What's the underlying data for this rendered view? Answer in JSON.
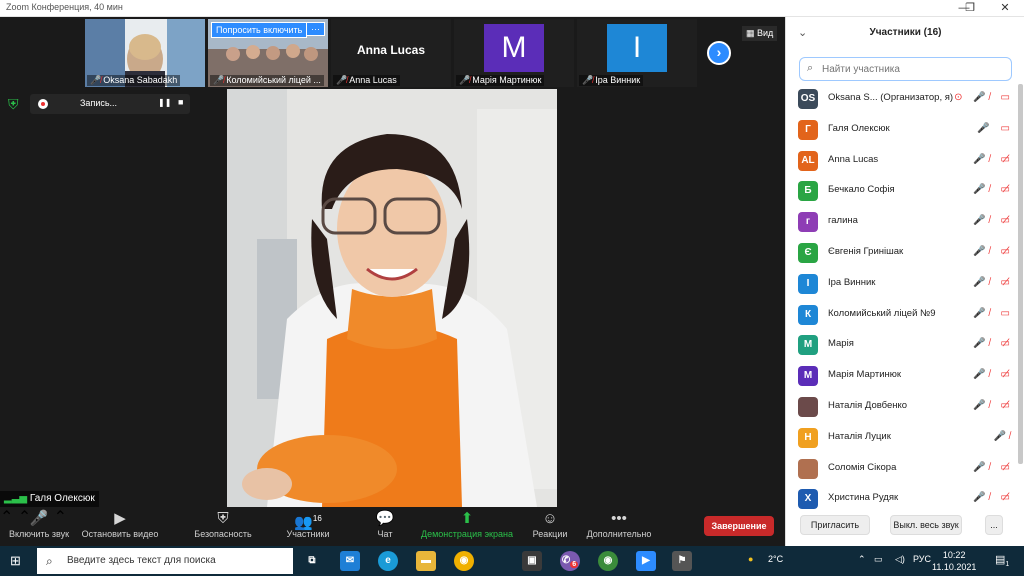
{
  "window": {
    "title": "Zoom Конференция, 40 мин",
    "min": "—",
    "max": "❐",
    "close": "✕"
  },
  "gallery": {
    "tiles": [
      {
        "name": "Oksana Sabadakh",
        "kind": "video",
        "bg": "#6a8fb0"
      },
      {
        "name": "Коломийський ліцей ...",
        "kind": "video",
        "bg": "#5d7b9d"
      },
      {
        "name": "Anna Lucas",
        "kind": "text",
        "big": "Anna Lucas"
      },
      {
        "name": "Марія Мартинюк",
        "kind": "avatar",
        "letter": "M",
        "color": "#5b2db8"
      },
      {
        "name": "Іра Винник",
        "kind": "avatar",
        "letter": "I",
        "color": "#1e87d6"
      }
    ],
    "ask_button": "Попросить включить",
    "more_button": "···",
    "next_button": "›",
    "view_button": "Вид"
  },
  "recording": {
    "label": "Запись...",
    "pause": "❚❚",
    "stop": "■"
  },
  "main_speaker": {
    "name": "Галя Олексюк"
  },
  "toolbar": {
    "unmute": "Включить звук",
    "stop_video": "Остановить видео",
    "security": "Безопасность",
    "participants": "Участники",
    "participants_count": "16",
    "chat": "Чат",
    "share": "Демонстрация экрана",
    "reactions": "Реакции",
    "more": "Дополнительно",
    "end": "Завершение"
  },
  "panel": {
    "title": "Участники (16)",
    "search_placeholder": "Найти участника",
    "participants": [
      {
        "initials": "OS",
        "name": "Oksana S...  (Организатор, я)",
        "color": "#3b4a5a",
        "icons": "⊙ 🎤̸ ▭"
      },
      {
        "initials": "Г",
        "name": "Галя Олексюк",
        "color": "#e2641b",
        "icons": "🎤 ▭"
      },
      {
        "initials": "AL",
        "name": "Anna Lucas",
        "color": "#e2641b",
        "icons": "🎤̸ ▭̸"
      },
      {
        "initials": "Б",
        "name": "Бечкало Софія",
        "color": "#2aa544",
        "icons": "🎤̸ ▭̸"
      },
      {
        "initials": "г",
        "name": "галина",
        "color": "#8e3db5",
        "icons": "🎤̸ ▭̸"
      },
      {
        "initials": "Є",
        "name": "Євгенія Гринішак",
        "color": "#2aa544",
        "icons": "🎤̸ ▭̸"
      },
      {
        "initials": "І",
        "name": "Іра Винник",
        "color": "#1e87d6",
        "icons": "🎤̸ ▭̸"
      },
      {
        "initials": "К",
        "name": "Коломийський ліцей №9",
        "color": "#1e87d6",
        "icons": "🎤̸ ▭"
      },
      {
        "initials": "М",
        "name": "Марія",
        "color": "#20a080",
        "icons": "🎤̸ ▭̸"
      },
      {
        "initials": "М",
        "name": "Марія Мартинюк",
        "color": "#5b2db8",
        "icons": "🎤̸ ▭̸"
      },
      {
        "initials": "",
        "name": "Наталія Довбенко",
        "color": "#6b4a4a",
        "icons": "🎤̸ ▭̸"
      },
      {
        "initials": "Н",
        "name": "Наталія Луцик",
        "color": "#f0a020",
        "icons": "🎤̸"
      },
      {
        "initials": "",
        "name": "Соломія Сікора",
        "color": "#b07050",
        "icons": "🎤̸ ▭̸"
      },
      {
        "initials": "Х",
        "name": "Христина Рудяк",
        "color": "#1e5bb0",
        "icons": "🎤̸ ▭̸"
      }
    ],
    "invite": "Пригласить",
    "mute_all": "Выкл. весь звук",
    "more": "..."
  },
  "taskbar": {
    "search_text": "Введите здесь текст для поиска",
    "weather": "2°C",
    "lang": "РУС",
    "time": "10:22",
    "date": "11.10.2021",
    "viber_badge": "6",
    "notif_badge": "1"
  }
}
